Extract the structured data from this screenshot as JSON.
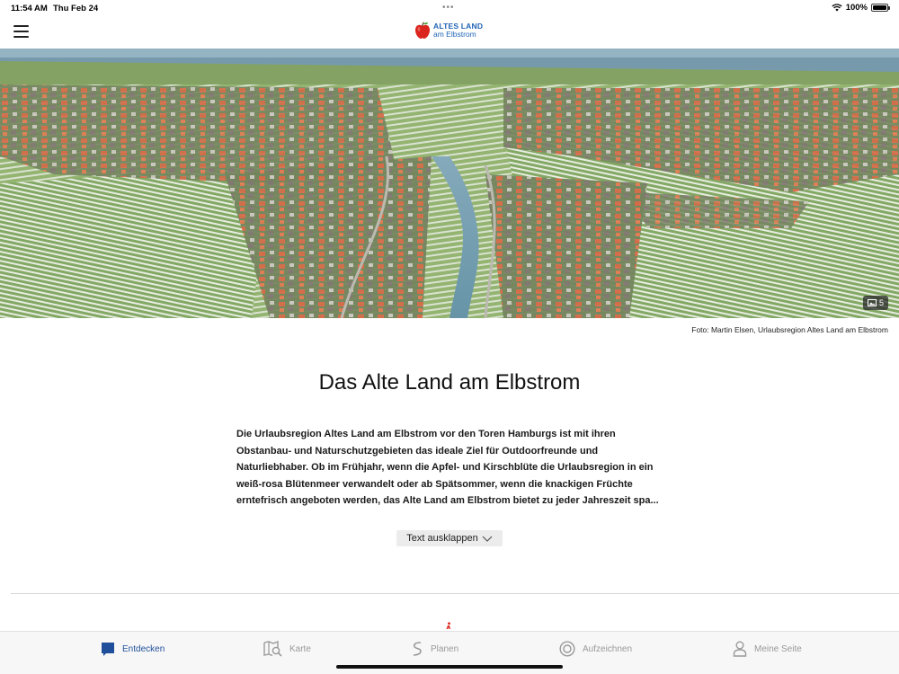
{
  "status_bar": {
    "time": "11:54 AM",
    "date": "Thu Feb 24",
    "battery": "100%"
  },
  "header": {
    "logo_line1": "ALTES LAND",
    "logo_line2": "am Elbstrom"
  },
  "hero": {
    "gallery_count": "5",
    "photo_credit": "Foto: Martin Elsen, Urlaubsregion Altes Land am Elbstrom"
  },
  "article": {
    "title": "Das Alte Land am Elbstrom",
    "intro": "Die Urlaubsregion Altes Land am Elbstrom vor den Toren Hamburgs ist mit ihren Obstanbau- und Naturschutzgebieten das ideale Ziel für Outdoorfreunde und Naturliebhaber. Ob im Frühjahr, wenn die Apfel- und Kirschblüte die Urlaubsregion in ein weiß-rosa Blütenmeer verwandelt oder ab Spätsommer, wenn die knackigen Früchte erntefrisch angeboten werden, das Alte Land am Elbstrom bietet zu jeder Jahreszeit spa...",
    "expand_label": "Text ausklappen"
  },
  "tabs": [
    {
      "label": "Entdecken",
      "icon": "discover-icon",
      "active": true
    },
    {
      "label": "Karte",
      "icon": "map-icon",
      "active": false
    },
    {
      "label": "Planen",
      "icon": "route-icon",
      "active": false
    },
    {
      "label": "Aufzeichnen",
      "icon": "record-icon",
      "active": false
    },
    {
      "label": "Meine Seite",
      "icon": "profile-icon",
      "active": false
    }
  ],
  "colors": {
    "brand_blue": "#1f63b5",
    "tab_active": "#1f4f9a",
    "tab_inactive": "#999999",
    "logo_apple": "#d9251d"
  }
}
